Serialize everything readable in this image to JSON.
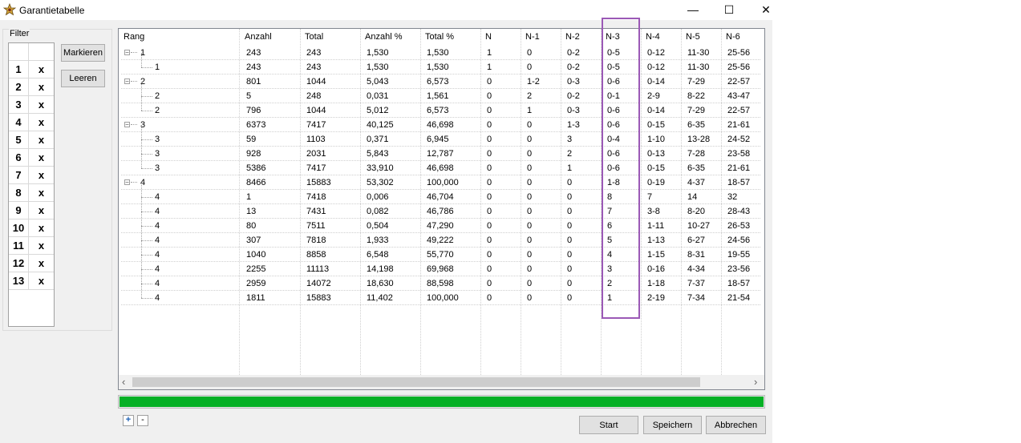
{
  "window": {
    "title": "Garantietabelle",
    "minimize_glyph": "—",
    "maximize_glyph": "☐",
    "close_glyph": "✕",
    "app_icon": "star-emblem-icon"
  },
  "filter": {
    "label": "Filter",
    "rows": [
      {
        "num": "1",
        "mark": "x"
      },
      {
        "num": "2",
        "mark": "x"
      },
      {
        "num": "3",
        "mark": "x"
      },
      {
        "num": "4",
        "mark": "x"
      },
      {
        "num": "5",
        "mark": "x"
      },
      {
        "num": "6",
        "mark": "x"
      },
      {
        "num": "7",
        "mark": "x"
      },
      {
        "num": "8",
        "mark": "x"
      },
      {
        "num": "9",
        "mark": "x"
      },
      {
        "num": "10",
        "mark": "x"
      },
      {
        "num": "11",
        "mark": "x"
      },
      {
        "num": "12",
        "mark": "x"
      },
      {
        "num": "13",
        "mark": "x"
      }
    ],
    "mark_button": "Markieren",
    "clear_button": "Leeren"
  },
  "table": {
    "columns": [
      "Rang",
      "Anzahl",
      "Total",
      "Anzahl %",
      "Total %",
      "N",
      "N-1",
      "N-2",
      "N-3",
      "N-4",
      "N-5",
      "N-6"
    ],
    "rows": [
      {
        "level": 0,
        "expand": "−",
        "cells": [
          "1",
          "243",
          "243",
          "1,530",
          "1,530",
          "1",
          "0",
          "0-2",
          "0-5",
          "0-12",
          "11-30",
          "25-56"
        ]
      },
      {
        "level": 1,
        "cells": [
          "1",
          "243",
          "243",
          "1,530",
          "1,530",
          "1",
          "0",
          "0-2",
          "0-5",
          "0-12",
          "11-30",
          "25-56"
        ]
      },
      {
        "level": 0,
        "expand": "−",
        "cells": [
          "2",
          "801",
          "1044",
          "5,043",
          "6,573",
          "0",
          "1-2",
          "0-3",
          "0-6",
          "0-14",
          "7-29",
          "22-57"
        ]
      },
      {
        "level": 1,
        "cells": [
          "2",
          "5",
          "248",
          "0,031",
          "1,561",
          "0",
          "2",
          "0-2",
          "0-1",
          "2-9",
          "8-22",
          "43-47"
        ]
      },
      {
        "level": 1,
        "cells": [
          "2",
          "796",
          "1044",
          "5,012",
          "6,573",
          "0",
          "1",
          "0-3",
          "0-6",
          "0-14",
          "7-29",
          "22-57"
        ]
      },
      {
        "level": 0,
        "expand": "−",
        "cells": [
          "3",
          "6373",
          "7417",
          "40,125",
          "46,698",
          "0",
          "0",
          "1-3",
          "0-6",
          "0-15",
          "6-35",
          "21-61"
        ]
      },
      {
        "level": 1,
        "cells": [
          "3",
          "59",
          "1103",
          "0,371",
          "6,945",
          "0",
          "0",
          "3",
          "0-4",
          "1-10",
          "13-28",
          "24-52"
        ]
      },
      {
        "level": 1,
        "cells": [
          "3",
          "928",
          "2031",
          "5,843",
          "12,787",
          "0",
          "0",
          "2",
          "0-6",
          "0-13",
          "7-28",
          "23-58"
        ]
      },
      {
        "level": 1,
        "cells": [
          "3",
          "5386",
          "7417",
          "33,910",
          "46,698",
          "0",
          "0",
          "1",
          "0-6",
          "0-15",
          "6-35",
          "21-61"
        ]
      },
      {
        "level": 0,
        "expand": "−",
        "cells": [
          "4",
          "8466",
          "15883",
          "53,302",
          "100,000",
          "0",
          "0",
          "0",
          "1-8",
          "0-19",
          "4-37",
          "18-57"
        ]
      },
      {
        "level": 1,
        "cells": [
          "4",
          "1",
          "7418",
          "0,006",
          "46,704",
          "0",
          "0",
          "0",
          "8",
          "7",
          "14",
          "32"
        ]
      },
      {
        "level": 1,
        "cells": [
          "4",
          "13",
          "7431",
          "0,082",
          "46,786",
          "0",
          "0",
          "0",
          "7",
          "3-8",
          "8-20",
          "28-43"
        ]
      },
      {
        "level": 1,
        "cells": [
          "4",
          "80",
          "7511",
          "0,504",
          "47,290",
          "0",
          "0",
          "0",
          "6",
          "1-11",
          "10-27",
          "26-53"
        ]
      },
      {
        "level": 1,
        "cells": [
          "4",
          "307",
          "7818",
          "1,933",
          "49,222",
          "0",
          "0",
          "0",
          "5",
          "1-13",
          "6-27",
          "24-56"
        ]
      },
      {
        "level": 1,
        "cells": [
          "4",
          "1040",
          "8858",
          "6,548",
          "55,770",
          "0",
          "0",
          "0",
          "4",
          "1-15",
          "8-31",
          "19-55"
        ]
      },
      {
        "level": 1,
        "cells": [
          "4",
          "2255",
          "11113",
          "14,198",
          "69,968",
          "0",
          "0",
          "0",
          "3",
          "0-16",
          "4-34",
          "23-56"
        ]
      },
      {
        "level": 1,
        "cells": [
          "4",
          "2959",
          "14072",
          "18,630",
          "88,598",
          "0",
          "0",
          "0",
          "2",
          "1-18",
          "7-37",
          "18-57"
        ]
      },
      {
        "level": 1,
        "cells": [
          "4",
          "1811",
          "15883",
          "11,402",
          "100,000",
          "0",
          "0",
          "0",
          "1",
          "2-19",
          "7-34",
          "21-54"
        ]
      }
    ],
    "highlight_column": "N-3",
    "highlight_color": "#9b59b6",
    "scroll_left_glyph": "‹",
    "scroll_right_glyph": "›",
    "scroll_thumb_fraction": 0.92
  },
  "progress": {
    "value_percent": 100,
    "color": "#06b025"
  },
  "footer": {
    "expand_all": "+",
    "collapse_all": "-",
    "start_button": "Start",
    "save_button": "Speichern",
    "cancel_button": "Abbrechen"
  }
}
